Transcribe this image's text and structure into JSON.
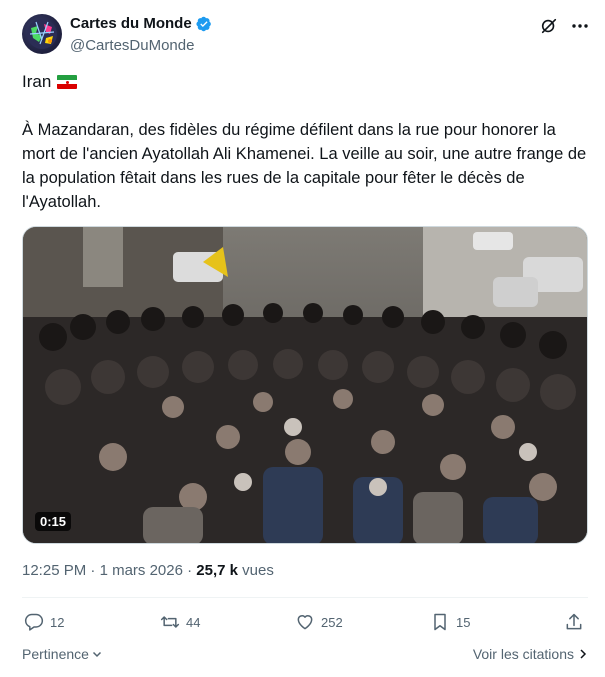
{
  "author": {
    "display_name": "Cartes du Monde",
    "handle": "@CartesDuMonde",
    "verified": true,
    "avatar_icon": "globe-map-icon",
    "verified_color": "#1d9bf0"
  },
  "tweet": {
    "line1": "Iran",
    "flag": "iran-flag",
    "flag_colors": [
      "#239f40",
      "#ffffff",
      "#da0000"
    ],
    "body": "À Mazandaran, des fidèles du régime défilent dans la rue pour honorer la mort de l'ancien Ayatollah Ali Khamenei. La veille au soir, une autre frange de la population fêtait dans les rues de la capitale pour fêter le décès de l'Ayatollah."
  },
  "media": {
    "type": "video",
    "duration": "0:15"
  },
  "meta": {
    "time": "12:25 PM",
    "sep1": " · ",
    "date": "1 mars 2026",
    "sep2": " · ",
    "views_count": "25,7 k",
    "views_label": " vues"
  },
  "actions": {
    "replies": "12",
    "reposts": "44",
    "likes": "252",
    "bookmarks": "15"
  },
  "footer": {
    "sort_label": "Pertinence",
    "quotes_label": "Voir les citations"
  },
  "colors": {
    "text_primary": "#0f1419",
    "text_secondary": "#536471",
    "divider": "#eff3f4"
  }
}
